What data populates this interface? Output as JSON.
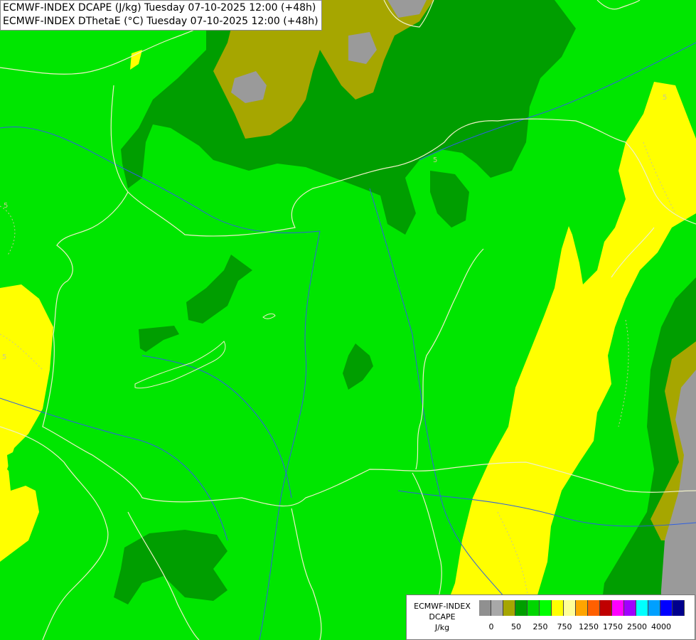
{
  "title": {
    "line1": "ECMWF-INDEX DCAPE (J/kg) Tuesday 07-10-2025 12:00 (+48h)",
    "line2": "ECMWF-INDEX DThetaE (°C) Tuesday 07-10-2025 12:00 (+48h)"
  },
  "contour_labels": [
    "5",
    "5",
    "5",
    "5"
  ],
  "legend": {
    "line1": "ECMWF-INDEX",
    "line2": "DCAPE",
    "line3": "J/kg",
    "colors": [
      "#909090",
      "#a8a8a8",
      "#a6a600",
      "#009e00",
      "#00d600",
      "#00ff00",
      "#ffff00",
      "#ffff99",
      "#ffa500",
      "#ff6000",
      "#c00000",
      "#ff00ff",
      "#a000ff",
      "#00ffff",
      "#00a0ff",
      "#0000ff",
      "#00008c"
    ],
    "ticks": [
      "0",
      "50",
      "250",
      "750",
      "1250",
      "1750",
      "2500",
      "4000"
    ]
  },
  "palette": {
    "bright_green": "#00e600",
    "mid_green": "#009e00",
    "olive": "#a6a600",
    "gray": "#9a9a9a",
    "yellow": "#ffff00",
    "border": "#f0f0c8"
  }
}
